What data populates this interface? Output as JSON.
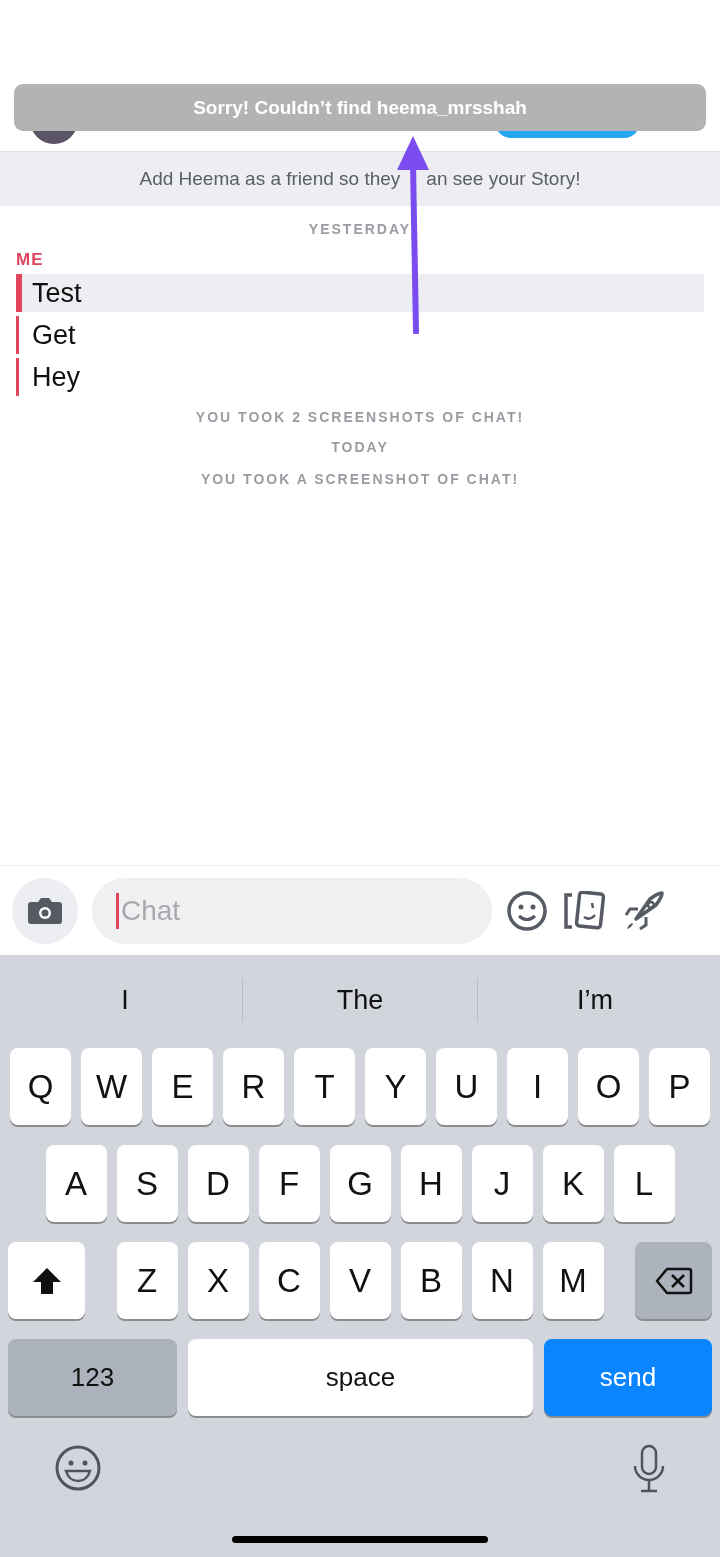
{
  "toast": {
    "text": "Sorry! Couldn’t find heema_mrsshah"
  },
  "banner": {
    "text_before": "Add Heema as a friend so they",
    "text_after": "an see your Story!"
  },
  "chat": {
    "items": [
      {
        "kind": "date",
        "text": "YESTERDAY"
      },
      {
        "kind": "sender",
        "text": "ME"
      },
      {
        "kind": "message",
        "text": "Test",
        "selected": true
      },
      {
        "kind": "message",
        "text": "Get",
        "selected": false
      },
      {
        "kind": "message",
        "text": "Hey",
        "selected": false
      },
      {
        "kind": "notice",
        "text": "YOU TOOK 2 SCREENSHOTS OF CHAT!"
      },
      {
        "kind": "date",
        "text": "TODAY"
      },
      {
        "kind": "notice",
        "text": "YOU TOOK A SCREENSHOT OF CHAT!"
      }
    ]
  },
  "composer": {
    "placeholder": "Chat"
  },
  "keyboard": {
    "suggestions": [
      "I",
      "The",
      "I’m"
    ],
    "rows": [
      [
        "Q",
        "W",
        "E",
        "R",
        "T",
        "Y",
        "U",
        "I",
        "O",
        "P"
      ],
      [
        "A",
        "S",
        "D",
        "F",
        "G",
        "H",
        "J",
        "K",
        "L"
      ],
      [
        "Z",
        "X",
        "C",
        "V",
        "B",
        "N",
        "M"
      ]
    ],
    "bottom_keys": [
      {
        "kind": "mode",
        "label": "123"
      },
      {
        "kind": "space",
        "label": "space"
      },
      {
        "kind": "send",
        "label": "send"
      }
    ]
  }
}
